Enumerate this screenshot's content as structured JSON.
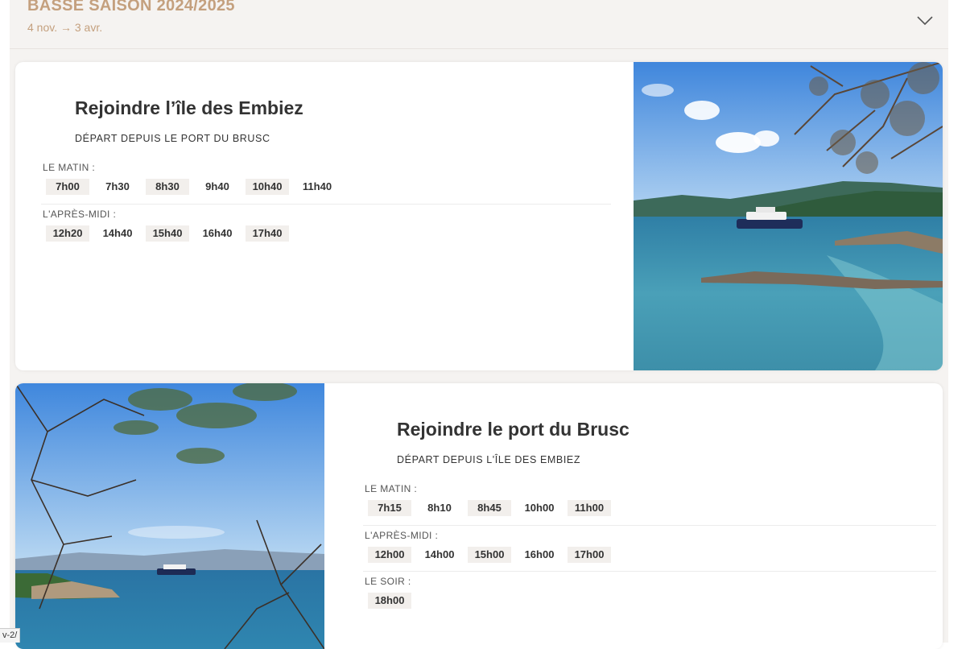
{
  "season": {
    "title": "BASSE SAISON 2024/2025",
    "dates": "4 nov. → 3 avr.",
    "toggle_icon": "chevron-down-icon"
  },
  "routes": [
    {
      "title": "Rejoindre l’île des Embiez",
      "subtitle": "DÉPART DEPUIS LE PORT DU BRUSC",
      "groups": [
        {
          "label": "LE MATIN :",
          "times": [
            "7h00",
            "7h30",
            "8h30",
            "9h40",
            "10h40",
            "11h40"
          ]
        },
        {
          "label": "L'APRÈS-MIDI :",
          "times": [
            "12h20",
            "14h40",
            "15h40",
            "16h40",
            "17h40"
          ]
        }
      ]
    },
    {
      "title": "Rejoindre le port du Brusc",
      "subtitle": "DÉPART DEPUIS L'ÎLE DES EMBIEZ",
      "groups": [
        {
          "label": "LE MATIN :",
          "times": [
            "7h15",
            "8h10",
            "8h45",
            "10h00",
            "11h00"
          ]
        },
        {
          "label": "L'APRÈS-MIDI :",
          "times": [
            "12h00",
            "14h00",
            "15h00",
            "16h00",
            "17h00"
          ]
        },
        {
          "label": "LE SOIR :",
          "times": [
            "18h00"
          ]
        }
      ]
    }
  ],
  "status_url": "v-2/"
}
